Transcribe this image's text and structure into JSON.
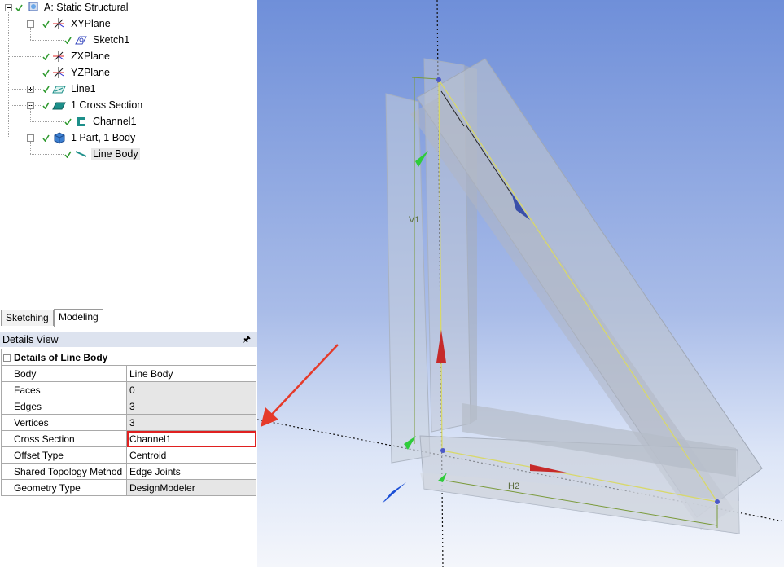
{
  "tree": [
    {
      "id": "static-structural",
      "label": "A: Static Structural",
      "level": 0,
      "expander": "minus",
      "icon": "model-icon"
    },
    {
      "id": "xyplane",
      "label": "XYPlane",
      "level": 1,
      "expander": "minus",
      "icon": "plane-axes-icon"
    },
    {
      "id": "sketch1",
      "label": "Sketch1",
      "level": 2,
      "expander": "none",
      "icon": "sketch-icon"
    },
    {
      "id": "zxplane",
      "label": "ZXPlane",
      "level": 1,
      "expander": "none",
      "icon": "plane-axes-icon"
    },
    {
      "id": "yzplane",
      "label": "YZPlane",
      "level": 1,
      "expander": "none",
      "icon": "plane-axes-icon"
    },
    {
      "id": "line1",
      "label": "Line1",
      "level": 1,
      "expander": "plus",
      "icon": "line-feature-icon"
    },
    {
      "id": "cross-section",
      "label": "1 Cross Section",
      "level": 1,
      "expander": "minus",
      "icon": "cross-section-icon"
    },
    {
      "id": "channel1",
      "label": "Channel1",
      "level": 2,
      "expander": "none",
      "icon": "channel-icon"
    },
    {
      "id": "parts",
      "label": "1 Part, 1 Body",
      "level": 1,
      "expander": "minus",
      "icon": "part-body-icon"
    },
    {
      "id": "line-body",
      "label": "Line Body",
      "level": 2,
      "expander": "none",
      "icon": "line-body-icon",
      "selected": true
    }
  ],
  "tabs": {
    "sketching": "Sketching",
    "modeling": "Modeling",
    "active": "modeling"
  },
  "details": {
    "panel_title": "Details View",
    "pin_icon": "pin-icon",
    "group_title": "Details of Line Body",
    "rows": [
      {
        "key": "Body",
        "value": "Line Body",
        "readonly": false
      },
      {
        "key": "Faces",
        "value": "0",
        "readonly": true
      },
      {
        "key": "Edges",
        "value": "3",
        "readonly": true
      },
      {
        "key": "Vertices",
        "value": "3",
        "readonly": true
      },
      {
        "key": "Cross Section",
        "value": "Channel1",
        "readonly": false,
        "highlighted": true
      },
      {
        "key": "Offset Type",
        "value": "Centroid",
        "readonly": false
      },
      {
        "key": "Shared Topology Method",
        "value": "Edge Joints",
        "readonly": false
      },
      {
        "key": "Geometry Type",
        "value": "DesignModeler",
        "readonly": true
      }
    ]
  },
  "viewport": {
    "dimension_labels": {
      "v1": "V1",
      "h2": "H2"
    },
    "highlight_color": "#e02020",
    "annotation": "red-arrow-pointing-to-cross-section"
  }
}
